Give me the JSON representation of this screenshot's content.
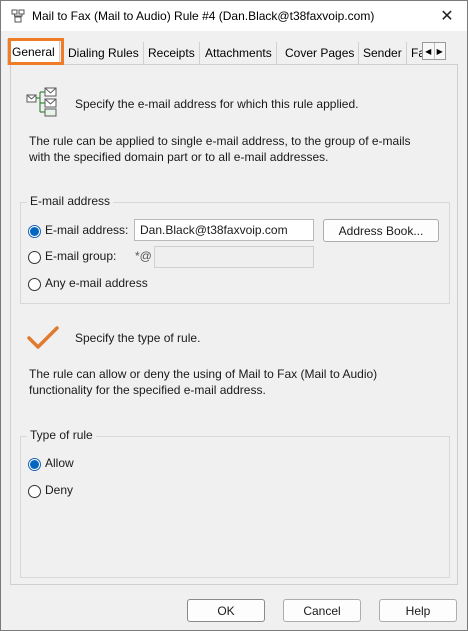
{
  "window": {
    "title": "Mail to Fax (Mail to Audio) Rule #4 (Dan.Black@t38faxvoip.com)",
    "close_glyph": "✕"
  },
  "tabs": [
    {
      "label": "General",
      "active": true
    },
    {
      "label": "Dialing Rules"
    },
    {
      "label": "Receipts"
    },
    {
      "label": "Attachments"
    },
    {
      "label": "Cover Pages"
    },
    {
      "label": "Sender"
    },
    {
      "label": "Fa"
    }
  ],
  "tab_scroll": {
    "left_glyph": "◀",
    "right_glyph": "▶"
  },
  "section1": {
    "heading": "Specify the e-mail address for which this rule applied.",
    "description_line1": "The rule can be applied to single e-mail address, to the group of e-mails",
    "description_line2": "with the specified domain part or to all e-mail addresses."
  },
  "email_group": {
    "label": "E-mail address",
    "option_address": "E-mail address:",
    "address_value": "Dan.Black@t38faxvoip.com",
    "address_book_button": "Address Book...",
    "option_group": "E-mail group:",
    "group_prefix": "*@",
    "group_value": "",
    "option_any": "Any e-mail address",
    "selected": "address"
  },
  "section2": {
    "heading": "Specify the type of rule.",
    "description_line1": "The rule can allow or deny the using of Mail to Fax (Mail to Audio)",
    "description_line2": "functionality for the specified e-mail address."
  },
  "rule_type": {
    "label": "Type of rule",
    "option_allow": "Allow",
    "option_deny": "Deny",
    "selected": "allow"
  },
  "footer": {
    "ok": "OK",
    "cancel": "Cancel",
    "help": "Help"
  },
  "colors": {
    "highlight": "#ef7d27",
    "checkmark": "#e07a2e",
    "radio_accent": "#0067c0"
  }
}
